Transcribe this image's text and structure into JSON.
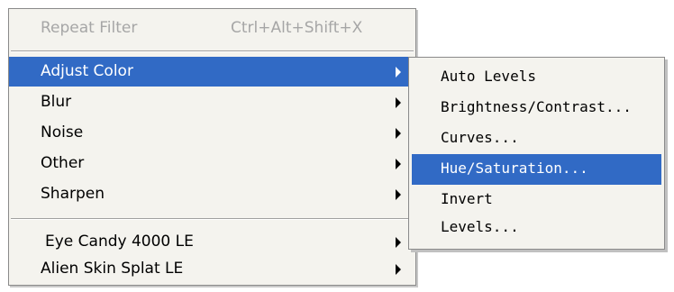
{
  "menu": {
    "items": [
      {
        "label": "Repeat Filter",
        "shortcut": "Ctrl+Alt+Shift+X",
        "disabled": true
      },
      {
        "label": "Adjust Color",
        "highlighted": true,
        "submenu": true
      },
      {
        "label": "Blur",
        "submenu": true
      },
      {
        "label": "Noise",
        "submenu": true
      },
      {
        "label": "Other",
        "submenu": true
      },
      {
        "label": "Sharpen",
        "submenu": true
      },
      {
        "label": "Eye Candy 4000 LE",
        "submenu": true
      },
      {
        "label": "Alien Skin Splat LE",
        "submenu": true
      }
    ]
  },
  "submenu": {
    "parent": "Adjust Color",
    "items": [
      {
        "label": "Auto Levels"
      },
      {
        "label": "Brightness/Contrast..."
      },
      {
        "label": "Curves..."
      },
      {
        "label": "Hue/Saturation...",
        "highlighted": true
      },
      {
        "label": "Invert"
      },
      {
        "label": "Levels..."
      }
    ]
  },
  "colors": {
    "highlight": "#316ac5",
    "menu_background": "#f4f3ee",
    "disabled_text": "#a6a6a6"
  },
  "icons": {
    "submenu_arrow": "chevron-right-icon"
  }
}
